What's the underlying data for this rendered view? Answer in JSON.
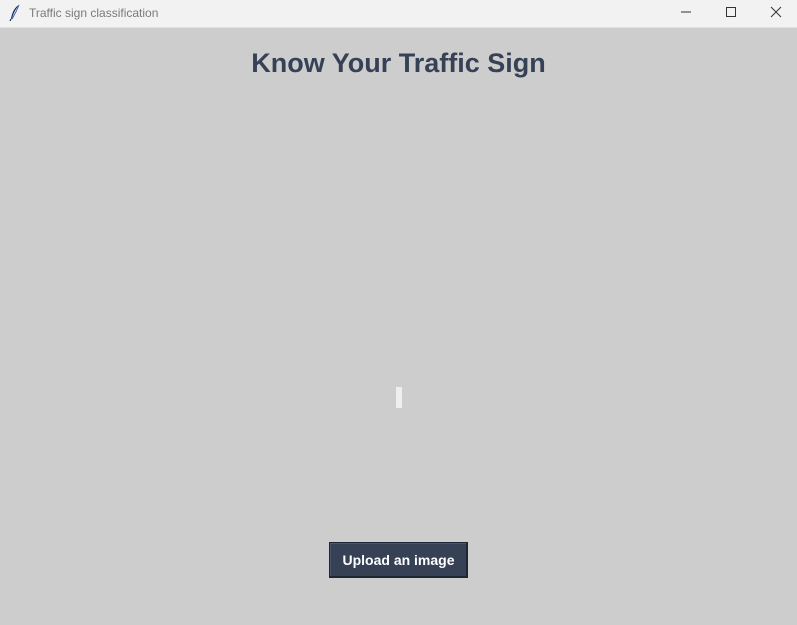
{
  "window": {
    "title": "Traffic sign classification",
    "icon": "feather-icon",
    "controls": [
      "minimize-icon",
      "maximize-icon",
      "close-icon"
    ]
  },
  "main": {
    "heading": "Know Your Traffic Sign",
    "upload_button_label": "Upload an image"
  },
  "colors": {
    "background": "#cdcdcd",
    "heading": "#364156",
    "button_bg": "#364156",
    "button_text": "#ffffff"
  }
}
